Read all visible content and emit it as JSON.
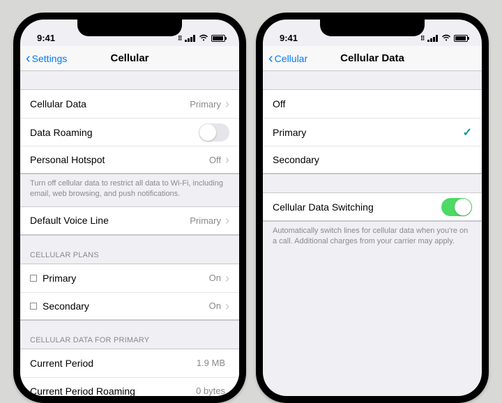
{
  "status": {
    "time": "9:41"
  },
  "left": {
    "nav": {
      "back": "Settings",
      "title": "Cellular"
    },
    "rows": {
      "cellularData": {
        "label": "Cellular Data",
        "value": "Primary"
      },
      "dataRoaming": {
        "label": "Data Roaming"
      },
      "hotspot": {
        "label": "Personal Hotspot",
        "value": "Off"
      }
    },
    "note1": "Turn off cellular data to restrict all data to Wi-Fi, including email, web browsing, and push notifications.",
    "voice": {
      "label": "Default Voice Line",
      "value": "Primary"
    },
    "plansHeader": "CELLULAR PLANS",
    "plans": {
      "primary": {
        "label": "Primary",
        "value": "On"
      },
      "secondary": {
        "label": "Secondary",
        "value": "On"
      }
    },
    "usageHeader": "CELLULAR DATA FOR PRIMARY",
    "usage": {
      "period": {
        "label": "Current Period",
        "value": "1.9 MB"
      },
      "roaming": {
        "label": "Current Period Roaming",
        "value": "0 bytes"
      }
    }
  },
  "right": {
    "nav": {
      "back": "Cellular",
      "title": "Cellular Data"
    },
    "options": {
      "off": "Off",
      "primary": "Primary",
      "secondary": "Secondary"
    },
    "switching": {
      "label": "Cellular Data Switching",
      "on": true
    },
    "note": "Automatically switch lines for cellular data when you're on a call. Additional charges from your carrier may apply."
  }
}
